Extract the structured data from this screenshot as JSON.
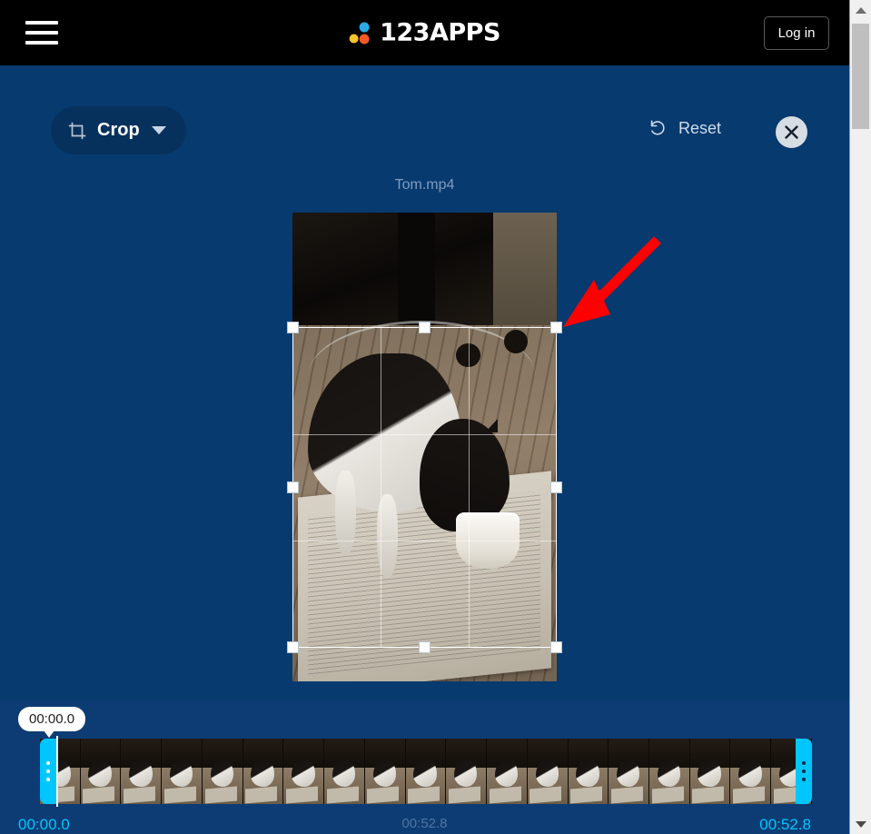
{
  "header": {
    "menu_icon": "hamburger-menu-icon",
    "brand_name": "123APPS",
    "brand_dots": [
      "#29abe2",
      "#f7c52b",
      "#f15a24"
    ],
    "login_label": "Log in",
    "background": "#000000"
  },
  "toolbar": {
    "tool_label": "Crop",
    "tool_icon": "crop-icon",
    "dropdown_icon": "chevron-down-icon",
    "reset_label": "Reset",
    "reset_icon": "undo-arrow-icon",
    "close_icon": "close-x-icon"
  },
  "editor": {
    "file_name": "Tom.mp4",
    "background": "#073a6e"
  },
  "crop": {
    "handle_count": 8,
    "grid_lines": "rule-of-thirds",
    "accent": "#ffffff"
  },
  "annotation": {
    "arrow_color": "#ff0000",
    "points_to": "crop-handle-top-right"
  },
  "timeline": {
    "tooltip_time": "00:00.0",
    "start_time": "00:00.0",
    "middle_time": "00:52.8",
    "end_time": "00:52.8",
    "handle_color": "#00c6ff",
    "thumbnail_count": 19
  },
  "scrollbar": {
    "up_icon": "triangle-up-icon",
    "down_icon": "triangle-down-icon"
  }
}
